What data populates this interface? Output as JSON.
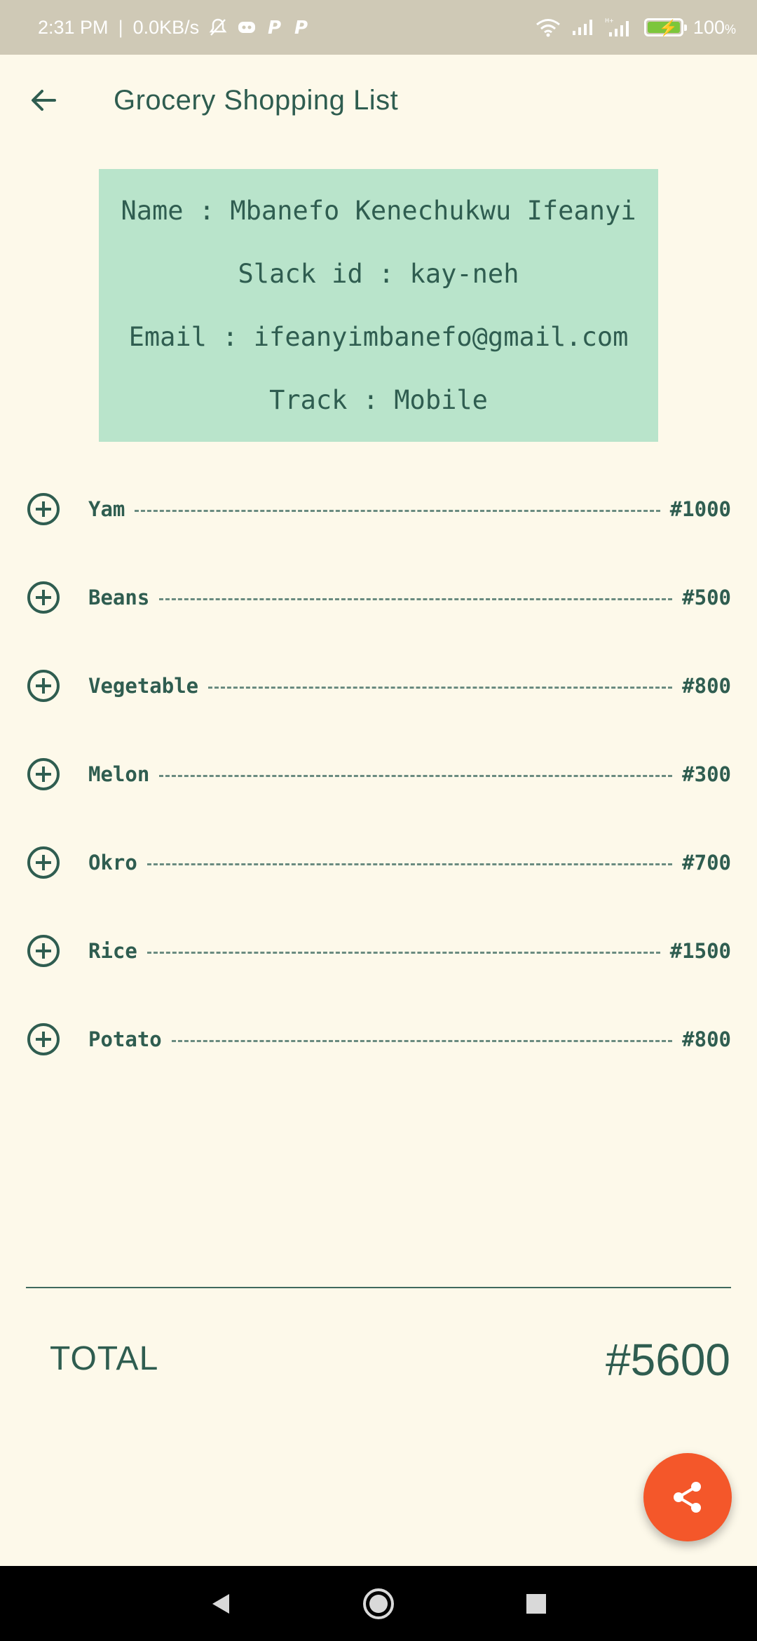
{
  "status_bar": {
    "time": "2:31 PM",
    "separator": "|",
    "speed": "0.0KB/s",
    "battery": "100",
    "battery_unit": "%",
    "icons": [
      "muted-bell-icon",
      "discord-icon",
      "p-icon",
      "p-icon",
      "wifi-icon",
      "signal-icon",
      "signal-icon",
      "battery-charging-icon"
    ]
  },
  "app_bar": {
    "title": "Grocery Shopping List",
    "back_icon": "arrow-back-icon"
  },
  "profile": {
    "name": "Name : Mbanefo Kenechukwu Ifeanyi",
    "slack": "Slack id : kay-neh",
    "email": "Email : ifeanyimbanefo@gmail.com",
    "track": "Track : Mobile"
  },
  "items": [
    {
      "name": "Yam",
      "price": "#1000"
    },
    {
      "name": "Beans",
      "price": "#500"
    },
    {
      "name": "Vegetable",
      "price": "#800"
    },
    {
      "name": "Melon",
      "price": "#300"
    },
    {
      "name": "Okro",
      "price": "#700"
    },
    {
      "name": "Rice",
      "price": "#1500"
    },
    {
      "name": "Potato",
      "price": "#800"
    }
  ],
  "total": {
    "label": "TOTAL",
    "value": "#5600"
  },
  "fab": {
    "icon": "share-icon"
  },
  "nav": {
    "back": "back-triangle-icon",
    "home": "home-circle-icon",
    "recents": "recents-square-icon"
  },
  "colors": {
    "background": "#fdf9ea",
    "primary_text": "#2f5d50",
    "card": "#b9e4cb",
    "fab": "#f4572a",
    "status_bar": "#cfc9b6"
  }
}
